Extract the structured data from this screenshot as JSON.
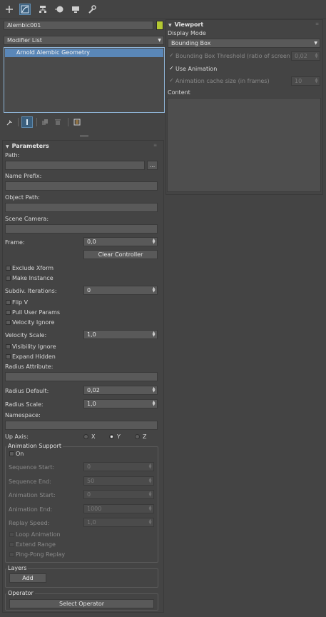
{
  "toolbar": {
    "tabs": [
      {
        "icon": "create-icon"
      },
      {
        "icon": "modify-icon"
      },
      {
        "icon": "hierarchy-icon"
      },
      {
        "icon": "motion-icon"
      },
      {
        "icon": "display-icon"
      },
      {
        "icon": "utilities-icon"
      }
    ]
  },
  "object": {
    "name": "Alembic001",
    "color": "#b4c832"
  },
  "modifier_list": {
    "label": "Modifier List",
    "stack_items": [
      "Arnold Alembic Geometry"
    ]
  },
  "parameters": {
    "title": "Parameters",
    "path_label": "Path:",
    "path_value": "",
    "browse_label": "...",
    "name_prefix_label": "Name Prefix:",
    "object_path_label": "Object Path:",
    "scene_camera_label": "Scene Camera:",
    "frame_label": "Frame:",
    "frame_value": "0,0",
    "clear_controller_label": "Clear Controller",
    "exclude_xform_label": "Exclude Xform",
    "make_instance_label": "Make Instance",
    "subdiv_label": "Subdiv. Iterations:",
    "subdiv_value": "0",
    "flip_v_label": "Flip V",
    "pull_user_params_label": "Pull User Params",
    "velocity_ignore_label": "Velocity Ignore",
    "velocity_scale_label": "Velocity Scale:",
    "velocity_scale_value": "1,0",
    "visibility_ignore_label": "Visibility Ignore",
    "expand_hidden_label": "Expand Hidden",
    "radius_attribute_label": "Radius Attribute:",
    "radius_default_label": "Radius Default:",
    "radius_default_value": "0,02",
    "radius_scale_label": "Radius Scale:",
    "radius_scale_value": "1,0",
    "namespace_label": "Namespace:",
    "up_axis_label": "Up Axis:",
    "up_axis_options": [
      "X",
      "Y",
      "Z"
    ],
    "up_axis_selected": "Y",
    "animation_support": {
      "title": "Animation Support",
      "on_label": "On",
      "sequence_start_label": "Sequence Start:",
      "sequence_start_value": "0",
      "sequence_end_label": "Sequence End:",
      "sequence_end_value": "50",
      "animation_start_label": "Animation Start:",
      "animation_start_value": "0",
      "animation_end_label": "Animation End:",
      "animation_end_value": "1000",
      "replay_speed_label": "Replay Speed:",
      "replay_speed_value": "1,0",
      "loop_animation_label": "Loop Animation",
      "extend_range_label": "Extend Range",
      "ping_pong_label": "Ping-Pong Replay"
    },
    "layers": {
      "title": "Layers",
      "add_label": "Add"
    },
    "operator": {
      "title": "Operator",
      "select_label": "Select Operator"
    }
  },
  "viewport": {
    "title": "Viewport",
    "display_mode_label": "Display Mode",
    "display_mode_value": "Bounding Box",
    "bbox_threshold_label": "Bounding Box Threshold (ratio of screen size)",
    "bbox_threshold_value": "0,02",
    "use_animation_label": "Use Animation",
    "cache_size_label": "Animation cache size (in frames)",
    "cache_size_value": "10",
    "content_label": "Content"
  }
}
